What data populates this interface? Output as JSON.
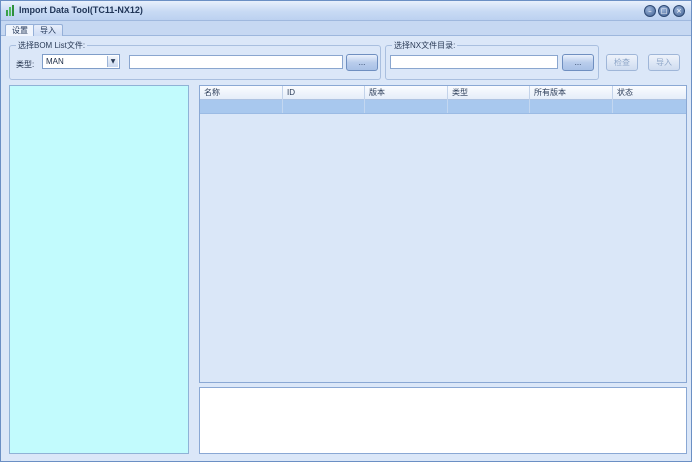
{
  "window": {
    "title": "Import Data Tool(TC11-NX12)",
    "controls": {
      "minimize": "–",
      "maximize": "□",
      "close": "×"
    }
  },
  "tabs": [
    {
      "label": "设置",
      "active": true
    },
    {
      "label": "导入",
      "active": false
    }
  ],
  "bom_group": {
    "legend": "选择BOM List文件:",
    "type_label": "类型:",
    "type_value": "MAN",
    "file_path": "",
    "browse_label": "..."
  },
  "nx_group": {
    "legend": "选择NX文件目录:",
    "dir_path": "",
    "browse_label": "..."
  },
  "actions": {
    "check_label": "检查",
    "import_label": "导入"
  },
  "table": {
    "columns": [
      "名称",
      "ID",
      "版本",
      "类型",
      "所有版本",
      "状态"
    ],
    "rows": [
      [
        "",
        "",
        "",
        "",
        "",
        ""
      ]
    ]
  },
  "colors": {
    "left_panel": "#c2fbfd",
    "selected_row": "#a8c8ee",
    "window_bg": "#dbe7f8"
  }
}
